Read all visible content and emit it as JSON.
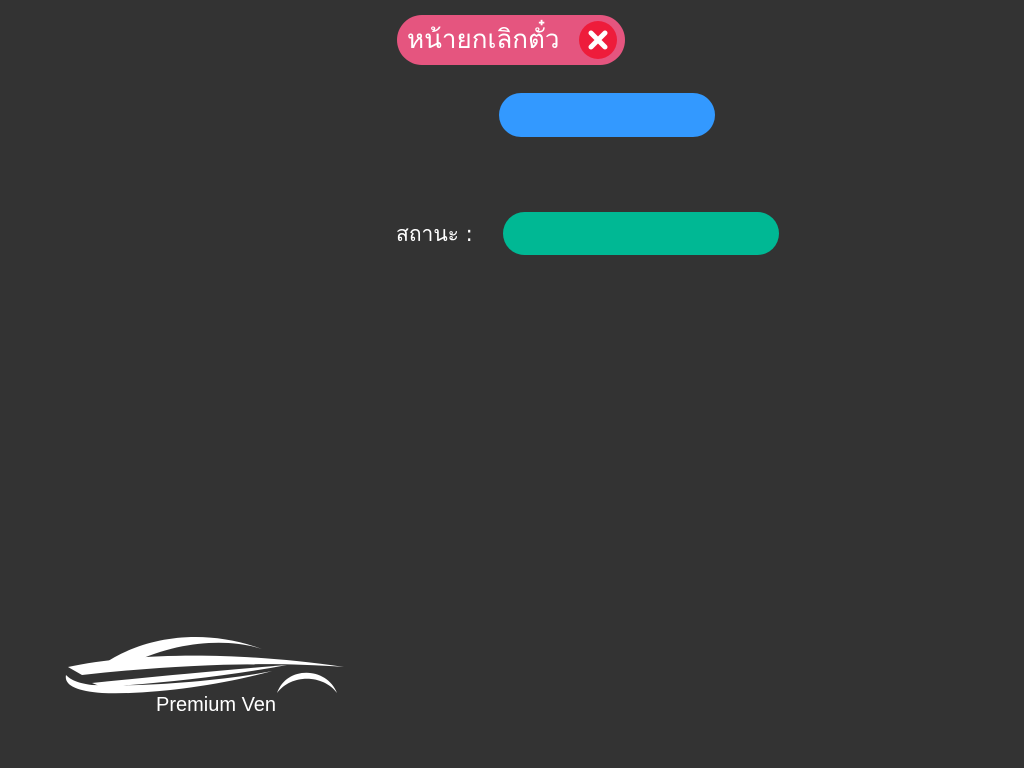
{
  "header": {
    "title": "หน้ายกเลิกตั๋ว",
    "close_icon": "close-icon",
    "colors": {
      "title_background": "#e5557f",
      "close_background": "#ee1c3b"
    }
  },
  "main": {
    "blue_field_value": "",
    "blue_field_color": "#3399ff",
    "status_label": "สถานะ :",
    "status_value": "",
    "status_color": "#00b894"
  },
  "logo": {
    "text": "Premium Ven",
    "icon": "car-silhouette-icon"
  },
  "colors": {
    "background": "#333333",
    "text": "#ffffff"
  }
}
